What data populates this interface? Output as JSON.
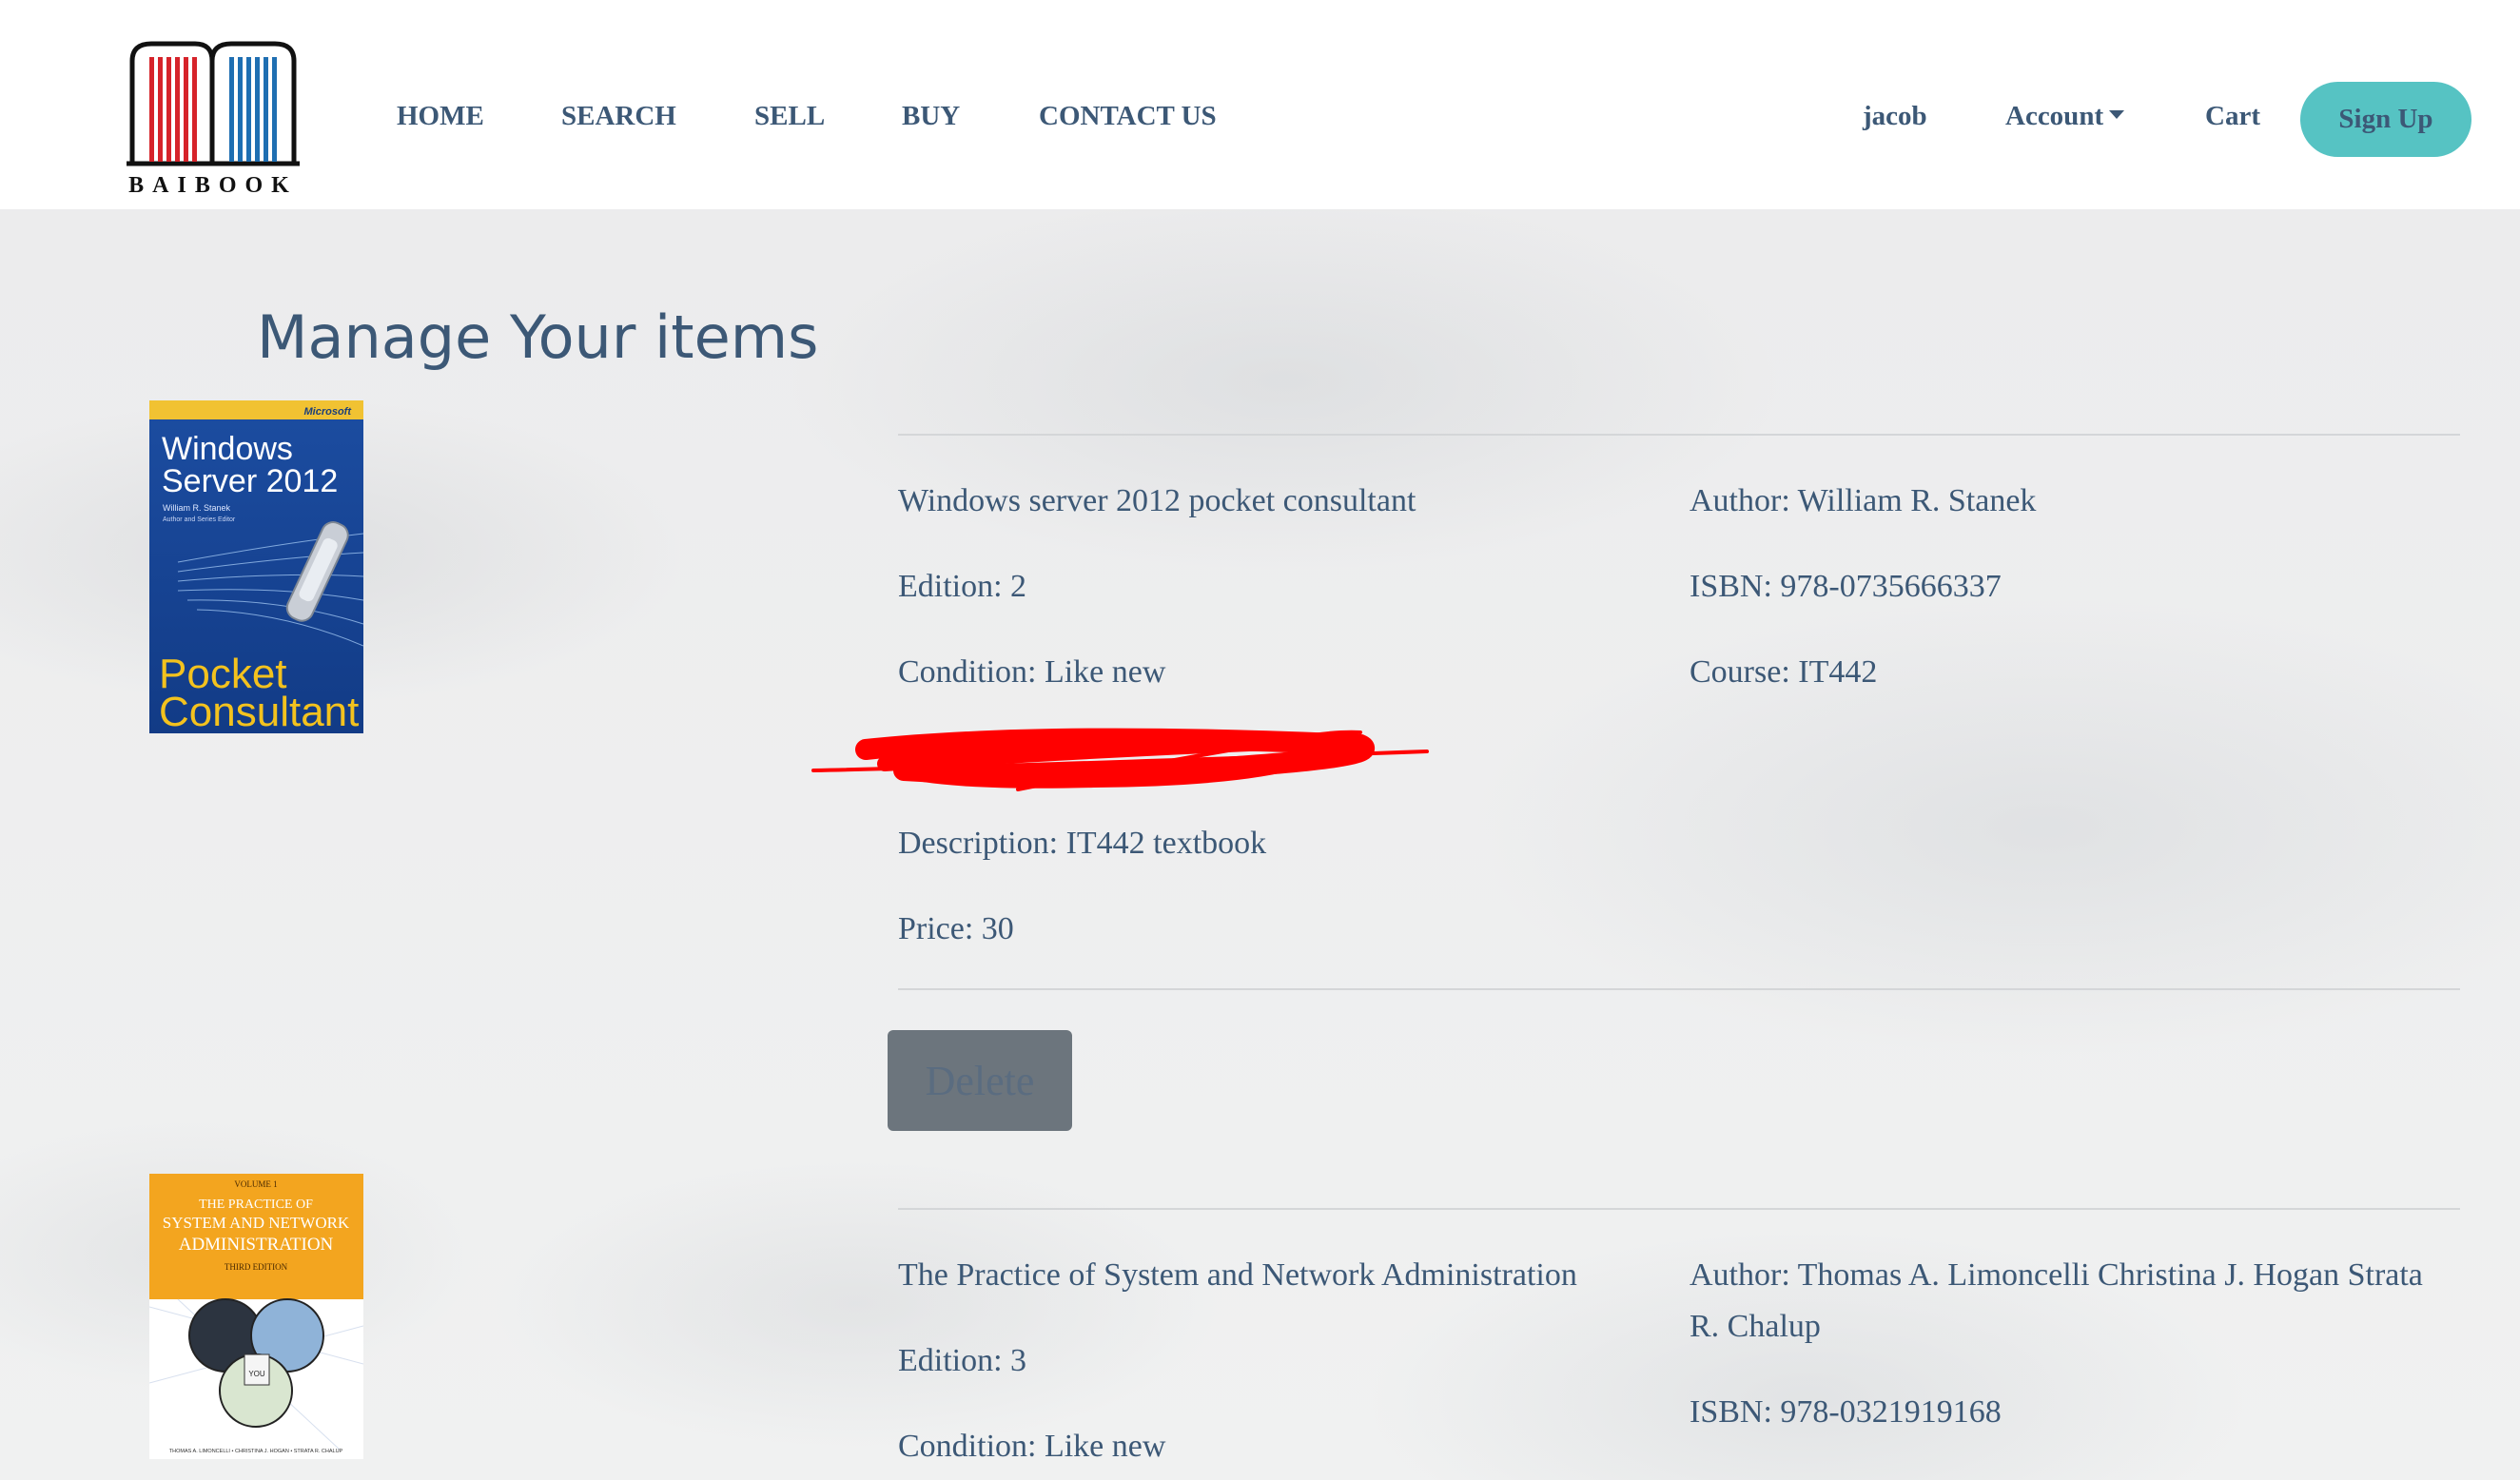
{
  "brand": {
    "logo_text": "BAIBOOK"
  },
  "nav": {
    "home": "HOME",
    "search": "SEARCH",
    "sell": "SELL",
    "buy": "BUY",
    "contact": "CONTACT US",
    "user": "jacob",
    "account": "Account",
    "cart": "Cart",
    "signup": "Sign Up"
  },
  "page": {
    "title": "Manage Your items"
  },
  "colors": {
    "primary_text": "#3c5876",
    "signup_bg": "#56c3c3",
    "delete_bg": "#6c757d",
    "redaction": "#ff0000"
  },
  "items": [
    {
      "cover": {
        "brand": "Microsoft",
        "title_line1": "Windows",
        "title_line2": "Server 2012",
        "author": "William R. Stanek",
        "subtitle": "Author and Series Editor",
        "series_line1": "Pocket",
        "series_line2": "Consultant"
      },
      "title": "Windows server 2012 pocket consultant",
      "author": "Author: William R. Stanek",
      "edition": "Edition: 2",
      "isbn": "ISBN: 978-0735666337",
      "condition": "Condition: Like new",
      "course": "Course: IT442",
      "description": "Description: IT442 textbook",
      "price": "Price: 30",
      "delete_label": "Delete"
    },
    {
      "cover": {
        "volume": "VOLUME 1",
        "title_line1": "THE PRACTICE OF",
        "title_line2": "SYSTEM AND NETWORK",
        "title_line3": "ADMINISTRATION",
        "edition": "THIRD EDITION",
        "you": "YOU",
        "authors": "THOMAS A. LIMONCELLI • CHRISTINA J. HOGAN • STRATA R. CHALUP"
      },
      "title": "The Practice of System and Network Administration",
      "author": "Author: Thomas A. Limoncelli Christina J. Hogan Strata R. Chalup",
      "edition": "Edition: 3",
      "isbn": "ISBN: 978-0321919168",
      "condition": "Condition: Like new"
    }
  ]
}
